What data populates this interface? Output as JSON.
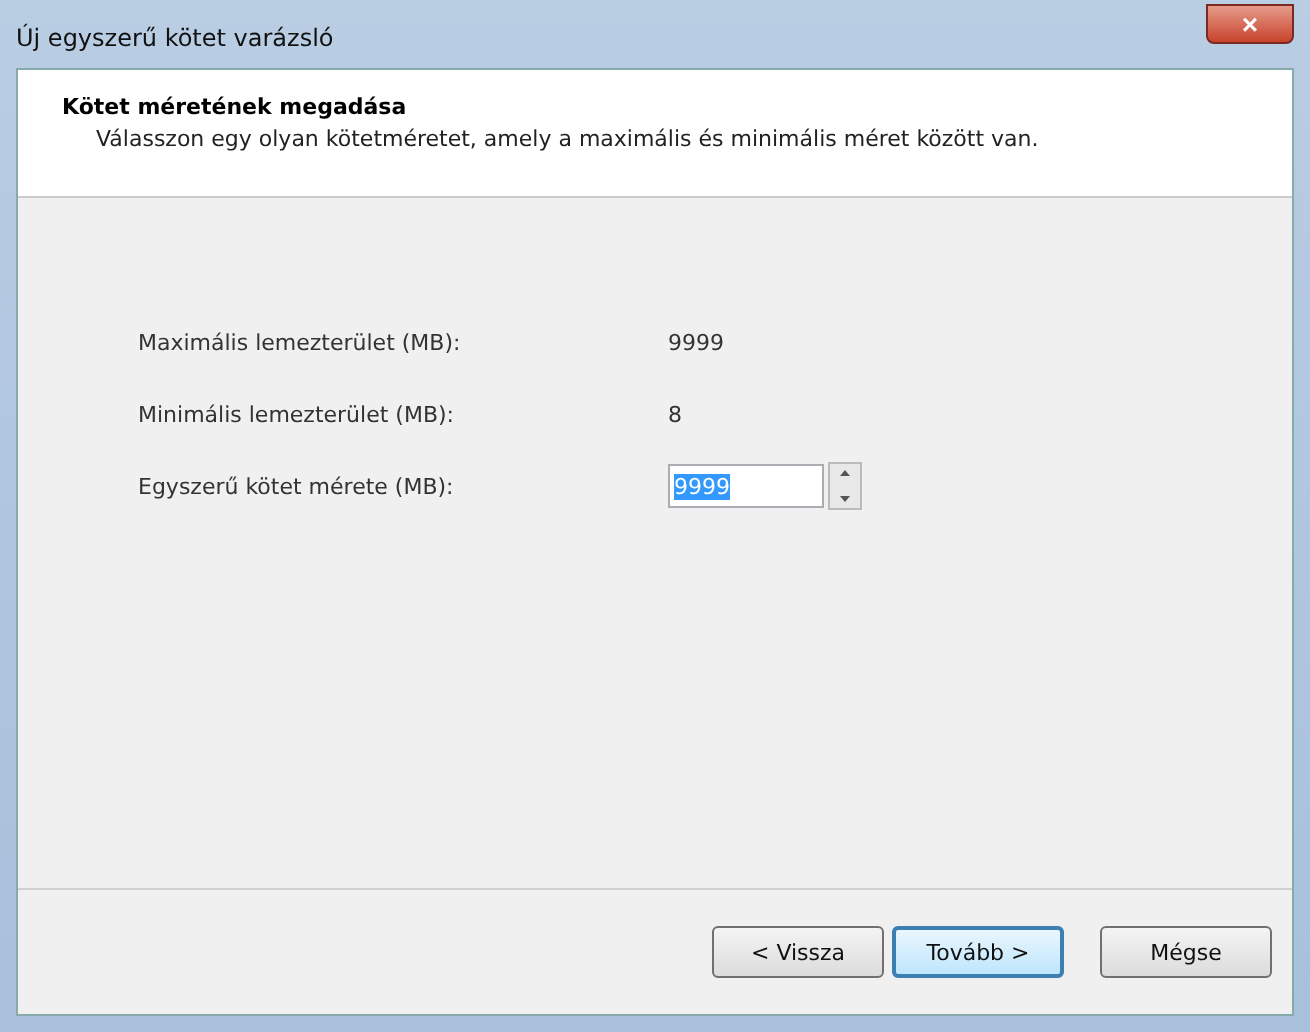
{
  "window": {
    "title": "Új egyszerű kötet varázsló",
    "close": "×"
  },
  "header": {
    "title": "Kötet méretének megadása",
    "description": "Válasszon egy olyan kötetméretet, amely a maximális és minimális méret között van."
  },
  "fields": [
    {
      "kind": "text",
      "label": "Maximális lemezterület (MB):",
      "value": "9999"
    },
    {
      "kind": "text",
      "label": "Minimális lemezterület (MB):",
      "value": "8"
    },
    {
      "kind": "spin",
      "label": "Egyszerű kötet mérete (MB):",
      "value": "9999"
    }
  ],
  "buttons": [
    {
      "label": "< Vissza",
      "default": false
    },
    {
      "label": "Tovább >",
      "default": true
    },
    {
      "label": "Mégse",
      "default": false
    }
  ]
}
